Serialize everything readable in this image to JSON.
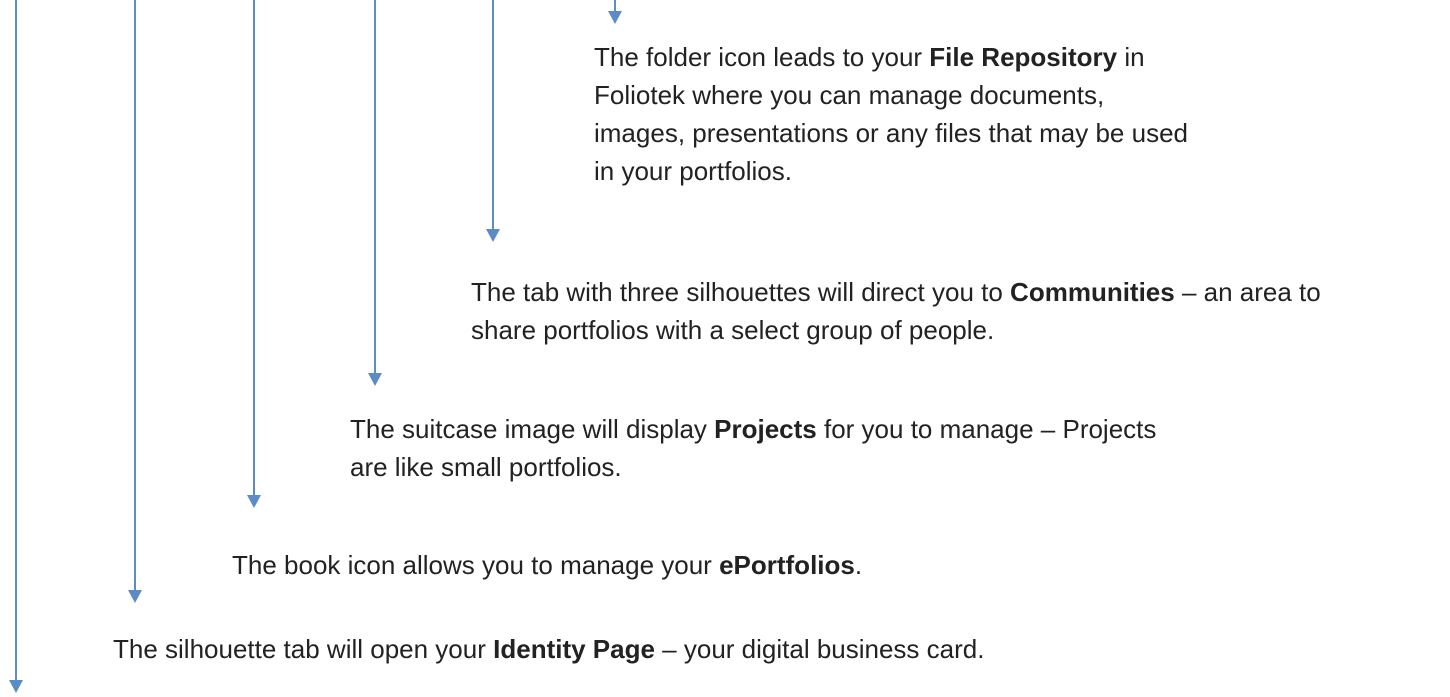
{
  "arrow_color": "#5B8CC6",
  "callouts": {
    "file_repository": {
      "before": "The folder icon leads to your ",
      "term": "File Repository",
      "after": " in Foliotek where you can manage documents, images, presentations or any files that may be used in your portfolios."
    },
    "communities": {
      "before": "The tab with three silhouettes will direct you to ",
      "term": "Communities",
      "after": " – an area to share portfolios with a select group of people."
    },
    "projects": {
      "before": "The suitcase image will display ",
      "term": "Projects",
      "after": " for you to manage – Projects are like small portfolios."
    },
    "eportfolios": {
      "before": "The book icon allows you to manage your ",
      "term": "ePortfolios",
      "after": "."
    },
    "identity": {
      "before": "The silhouette tab will open your ",
      "term": "Identity Page",
      "after": " – your digital business card."
    }
  }
}
